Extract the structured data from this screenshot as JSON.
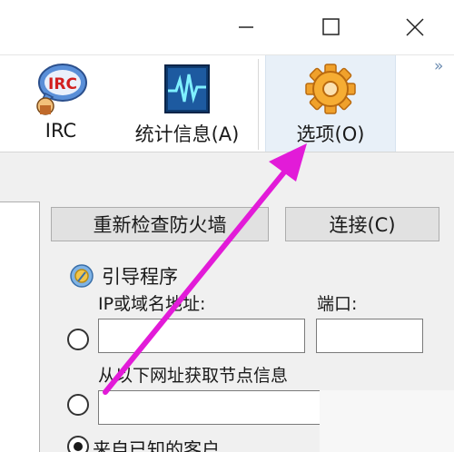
{
  "window": {
    "minimize_icon": "minimize-icon",
    "maximize_icon": "maximize-icon",
    "close_icon": "close-icon"
  },
  "toolbar": {
    "items": [
      {
        "label": "IRC",
        "icon": "irc-icon"
      },
      {
        "label": "统计信息(A)",
        "icon": "statistics-icon"
      },
      {
        "label": "选项(O)",
        "icon": "gear-icon"
      }
    ],
    "overflow": "»"
  },
  "actions": {
    "recheck_firewall": "重新检查防火墙",
    "connect": "连接(C)"
  },
  "bootstrap": {
    "title": "引导程序",
    "ip_label": "IP或域名地址:",
    "port_label": "端口:",
    "ip_value": "",
    "port_value": "",
    "url_label": "从以下网址获取节点信息",
    "url_value": "",
    "known_clients_label": "来自已知的客户"
  },
  "annotation": {
    "arrow_color": "#e21bd8"
  }
}
